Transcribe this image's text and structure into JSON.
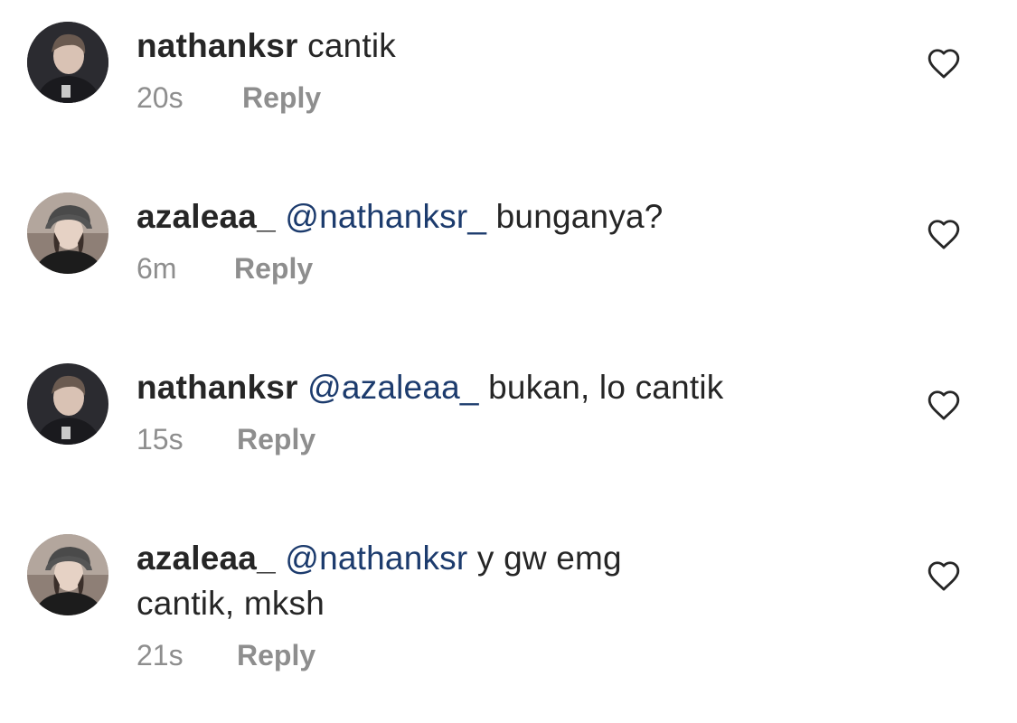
{
  "comments": [
    {
      "username": "nathanksr",
      "mention": "",
      "text": "cantik",
      "time": "20s",
      "reply_label": "Reply",
      "avatar": "male-user-avatar"
    },
    {
      "username": "azaleaa_",
      "mention": "@nathanksr_",
      "text": "bunganya?",
      "time": "6m",
      "reply_label": "Reply",
      "avatar": "female-user-avatar"
    },
    {
      "username": "nathanksr",
      "mention": "@azaleaa_",
      "text": "bukan, lo cantik",
      "time": "15s",
      "reply_label": "Reply",
      "avatar": "male-user-avatar"
    },
    {
      "username": "azaleaa_",
      "mention": "@nathanksr",
      "text": "y gw emg cantik, mksh",
      "time": "21s",
      "reply_label": "Reply",
      "avatar": "female-user-avatar"
    }
  ],
  "colors": {
    "text": "#262626",
    "mention": "#1c3b6d",
    "meta": "#8e8e8e",
    "icon": "#262626"
  },
  "icons": {
    "like": "heart-outline-icon"
  }
}
